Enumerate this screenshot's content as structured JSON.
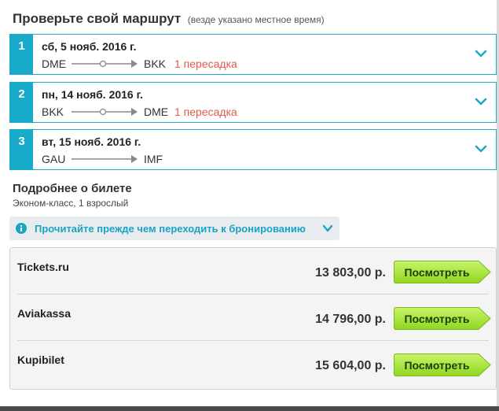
{
  "header": {
    "title": "Проверьте свой маршрут",
    "subtitle": "(везде указано местное время)"
  },
  "segments": [
    {
      "num": "1",
      "date": "сб, 5 нояб. 2016 г.",
      "from": "DME",
      "to": "BKK",
      "stops": "1 пересадка"
    },
    {
      "num": "2",
      "date": "пн, 14 нояб. 2016 г.",
      "from": "BKK",
      "to": "DME",
      "stops": "1 пересадка"
    },
    {
      "num": "3",
      "date": "вт, 15 нояб. 2016 г.",
      "from": "GAU",
      "to": "IMF",
      "stops": ""
    }
  ],
  "details": {
    "title": "Подробнее о билете",
    "subtitle": "Эконом-класс, 1 взрослый"
  },
  "notice": {
    "text": "Прочитайте прежде чем переходить к бронированию",
    "icon": "info-icon"
  },
  "offers": [
    {
      "agency": "Tickets.ru",
      "price": "13 803,00 р.",
      "button": "Посмотреть"
    },
    {
      "agency": "Aviakassa",
      "price": "14 796,00 р.",
      "button": "Посмотреть"
    },
    {
      "agency": "Kupibilet",
      "price": "15 604,00 р.",
      "button": "Посмотреть"
    }
  ],
  "colors": {
    "accent": "#19a9c9",
    "stops": "#e05a4a",
    "button": "#9be22d"
  }
}
